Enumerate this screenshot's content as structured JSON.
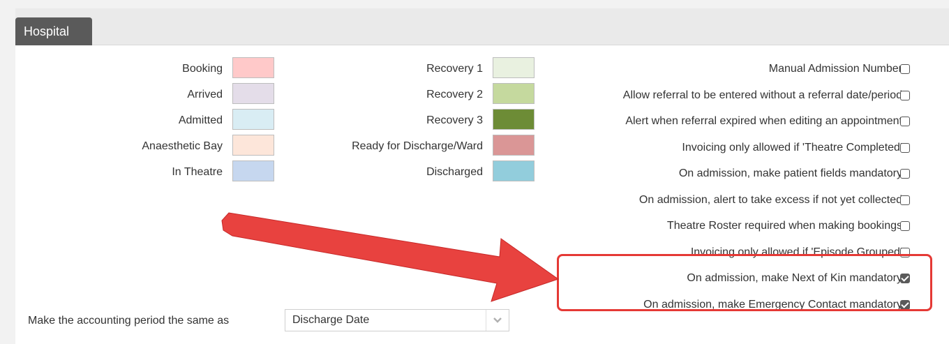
{
  "section": {
    "title": "Hospital"
  },
  "status_colors_left": [
    {
      "label": "Booking",
      "color": "#ffc9c9"
    },
    {
      "label": "Arrived",
      "color": "#e4dde9"
    },
    {
      "label": "Admitted",
      "color": "#d9edf4"
    },
    {
      "label": "Anaesthetic Bay",
      "color": "#fde6da"
    },
    {
      "label": "In Theatre",
      "color": "#c6d7ef"
    }
  ],
  "status_colors_middle": [
    {
      "label": "Recovery 1",
      "color": "#e9f1e0"
    },
    {
      "label": "Recovery 2",
      "color": "#c5d99e"
    },
    {
      "label": "Recovery 3",
      "color": "#6d8c36"
    },
    {
      "label": "Ready for Discharge/Ward",
      "color": "#da9696"
    },
    {
      "label": "Discharged",
      "color": "#92cddc"
    }
  ],
  "options": [
    {
      "label": "Manual Admission Number",
      "checked": false
    },
    {
      "label": "Allow referral to be entered without a referral date/period",
      "checked": false
    },
    {
      "label": "Alert when referral expired when editing an appointment",
      "checked": false
    },
    {
      "label": "Invoicing only allowed if 'Theatre Completed'",
      "checked": false
    },
    {
      "label": "On admission, make patient fields mandatory",
      "checked": false
    },
    {
      "label": "On admission, alert to take excess if not yet collected",
      "checked": false
    },
    {
      "label": "Theatre Roster required when making bookings",
      "checked": false
    },
    {
      "label": "Invoicing only allowed if 'Episode Grouped'",
      "checked": false
    },
    {
      "label": "On admission, make Next of Kin mandatory",
      "checked": true
    },
    {
      "label": "On admission, make Emergency Contact mandatory",
      "checked": true
    }
  ],
  "accounting": {
    "label": "Make the accounting period the same as",
    "selected": "Discharge Date"
  },
  "colors": {
    "highlight": "#e53935",
    "arrow": "#e8423f",
    "tab_bg": "#5a5a5a"
  }
}
